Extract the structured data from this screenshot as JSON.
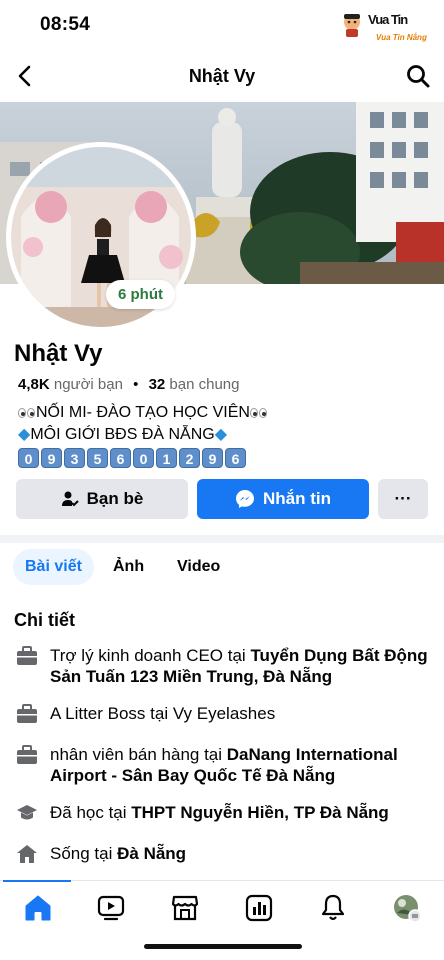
{
  "status": {
    "time": "08:54"
  },
  "watermark": {
    "text": "Vua Tin",
    "sub": "Vua Tin Nắng"
  },
  "header": {
    "title": "Nhật Vy"
  },
  "profile": {
    "name": "Nhật Vy",
    "story_badge": "6 phút",
    "friends_count": "4,8K",
    "friends_label": "người bạn",
    "separator": "•",
    "mutual_count": "32",
    "mutual_label": "bạn chung",
    "bio_line1": "NỐI MI- ĐÀO TẠO HỌC VIÊN",
    "bio_line2": "MÔI GIỚI BĐS ĐÀ NẴNG",
    "phone_digits": [
      "0",
      "9",
      "3",
      "5",
      "6",
      "0",
      "1",
      "2",
      "9",
      "6"
    ]
  },
  "actions": {
    "friends": "Bạn bè",
    "message": "Nhắn tin",
    "more": "···"
  },
  "tabs": [
    {
      "label": "Bài viết"
    },
    {
      "label": "Ảnh"
    },
    {
      "label": "Video"
    }
  ],
  "details": {
    "title": "Chi tiết",
    "items": [
      {
        "icon": "briefcase-icon",
        "prefix": "Trợ lý kinh doanh CEO tại ",
        "bold": "Tuyển Dụng Bất Động Sản Tuấn 123 Miền Trung, Đà Nẵng"
      },
      {
        "icon": "briefcase-icon",
        "prefix": "A Litter Boss tại Vy Eyelashes",
        "bold": ""
      },
      {
        "icon": "briefcase-icon",
        "prefix": "nhân viên bán hàng tại ",
        "bold": "DaNang International Airport - Sân Bay Quốc Tế Đà Nẵng"
      },
      {
        "icon": "graduation-cap-icon",
        "prefix": "Đã học tại ",
        "bold": "THPT Nguyễn Hiền, TP Đà Nẵng"
      },
      {
        "icon": "house-icon",
        "prefix": "Sống tại ",
        "bold": "Đà Nẵng"
      }
    ]
  },
  "bottom_nav": [
    "home-icon",
    "video-icon",
    "marketplace-icon",
    "feeds-icon",
    "bell-icon",
    "profile-avatar"
  ],
  "colors": {
    "accent": "#1877f2",
    "secondary_button": "#e4e6eb",
    "story_badge": "#2d7a3f"
  }
}
